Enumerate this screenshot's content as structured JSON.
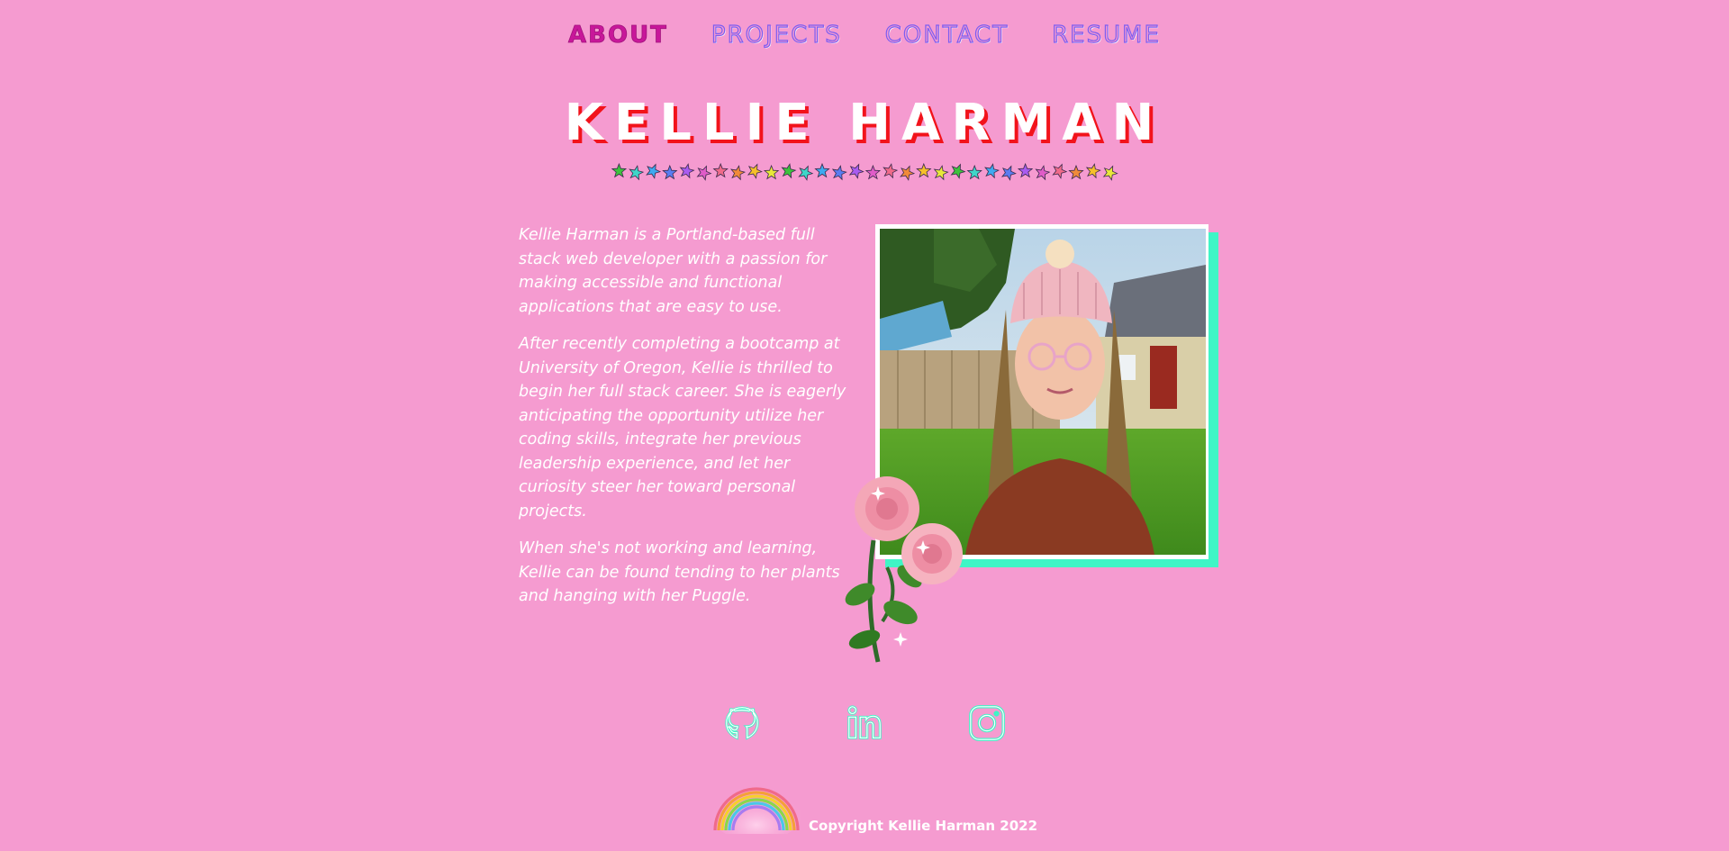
{
  "nav": {
    "items": [
      {
        "label": "ABOUT",
        "active": true
      },
      {
        "label": "PROJECTS",
        "active": false
      },
      {
        "label": "CONTACT",
        "active": false
      },
      {
        "label": "RESUME",
        "active": false
      }
    ]
  },
  "header": {
    "name": "KELLIE HARMAN",
    "star_colors": [
      "#3ec23e",
      "#3fd6c8",
      "#3fa9f0",
      "#5b7cf0",
      "#a95cf0",
      "#e05cc8",
      "#f06a8a",
      "#f08a3a",
      "#f5c02a",
      "#e8e83a"
    ]
  },
  "about": {
    "paragraphs": [
      "Kellie Harman is a Portland-based full stack web developer with a passion for making accessible and functional applications that are easy to use.",
      "After recently completing a bootcamp at University of Oregon, Kellie is thrilled to begin her full stack career. She is eagerly anticipating the opportunity utilize her coding skills, integrate her previous leadership experience, and let her curiosity steer her toward personal projects.",
      "When she's not working and learning, Kellie can be found tending to her plants and hanging with her Puggle."
    ]
  },
  "social": {
    "icons": [
      "github-icon",
      "linkedin-icon",
      "instagram-icon"
    ]
  },
  "footer": {
    "copyright": "Copyright Kellie Harman 2022"
  },
  "colors": {
    "background": "#f59bd0",
    "accent_mint": "#3ff5c6",
    "title_shadow": "#f2131b",
    "nav_active": "#c8179a",
    "nav_stroke": "#7d5cf0"
  }
}
